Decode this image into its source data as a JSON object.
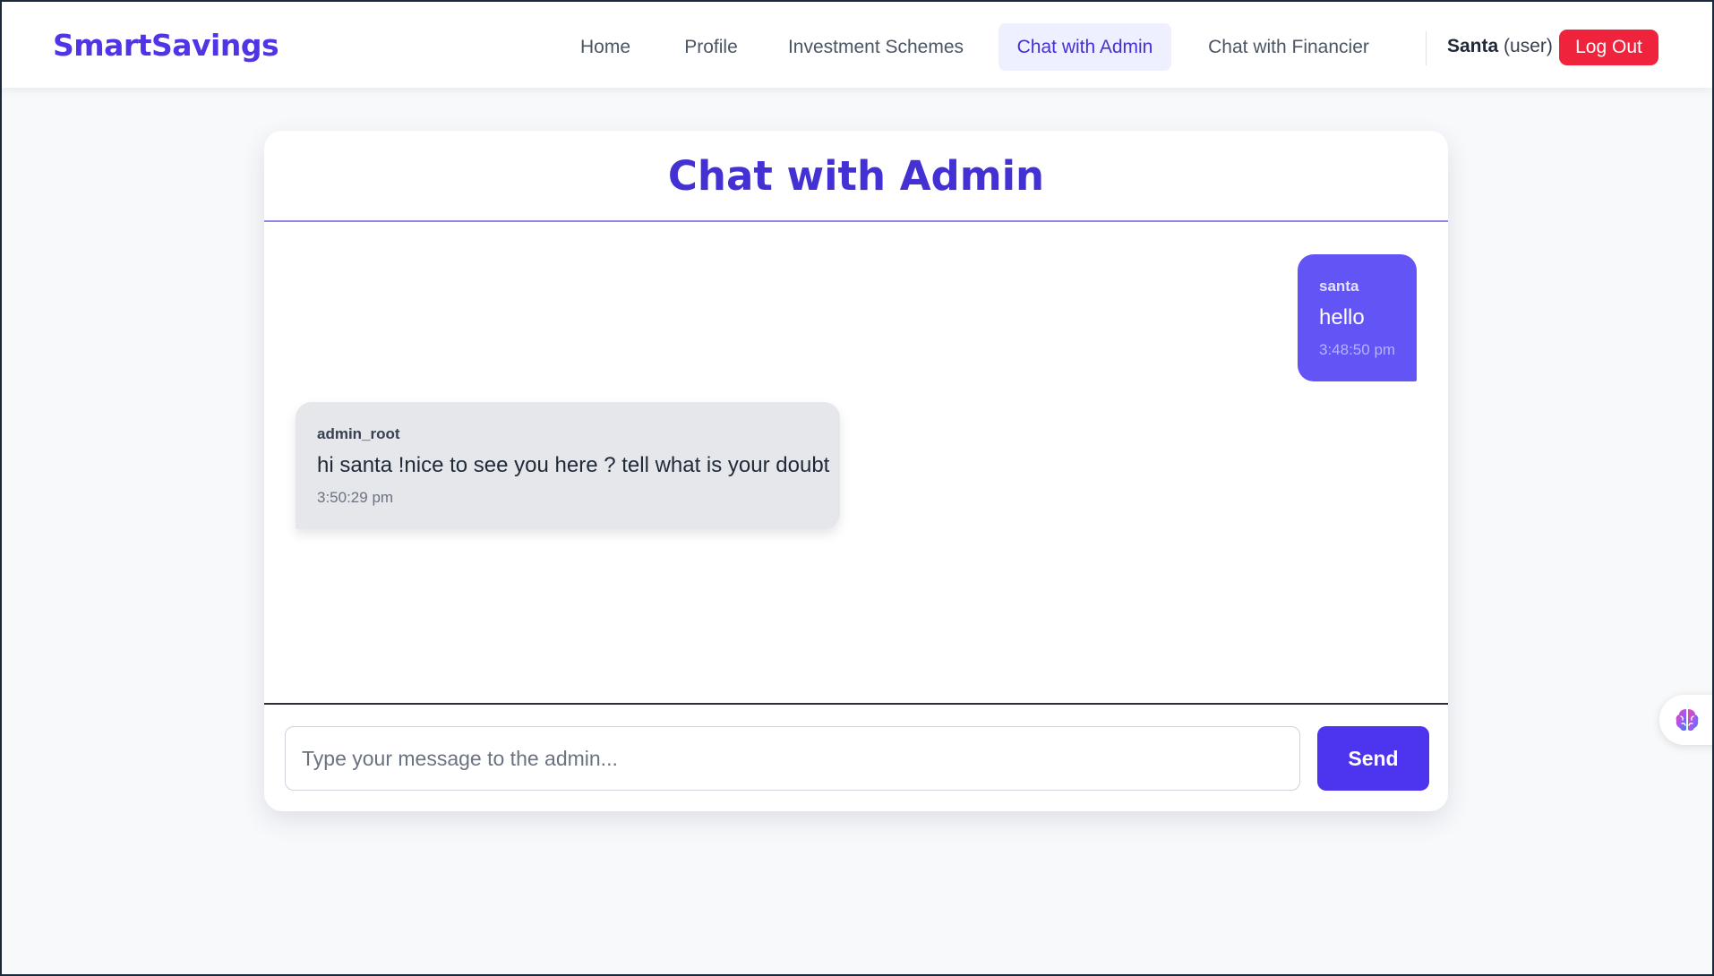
{
  "app": {
    "brand": "SmartSavings"
  },
  "nav": {
    "items": [
      {
        "label": "Home"
      },
      {
        "label": "Profile"
      },
      {
        "label": "Investment Schemes"
      },
      {
        "label": "Chat with Admin",
        "active": true
      },
      {
        "label": "Chat with Financier"
      }
    ]
  },
  "user": {
    "name": "Santa",
    "role": "(user)",
    "logout_label": "Log Out"
  },
  "chat": {
    "title": "Chat with Admin",
    "messages": [
      {
        "sender": "santa",
        "text": "hello",
        "time": "3:48:50 pm",
        "direction": "outgoing"
      },
      {
        "sender": "admin_root",
        "text": "hi santa !nice to see you here ? tell what is your doubt",
        "time": "3:50:29 pm",
        "direction": "incoming"
      }
    ],
    "input_placeholder": "Type your message to the admin...",
    "input_value": "",
    "send_label": "Send"
  },
  "widget": {
    "icon": "brain-icon"
  },
  "colors": {
    "brand": "#4f35e6",
    "accent": "#4331d4",
    "outgoing_bubble": "#6355f5",
    "incoming_bubble": "#e5e7eb",
    "logout": "#ef233c",
    "send": "#4d35f0"
  }
}
